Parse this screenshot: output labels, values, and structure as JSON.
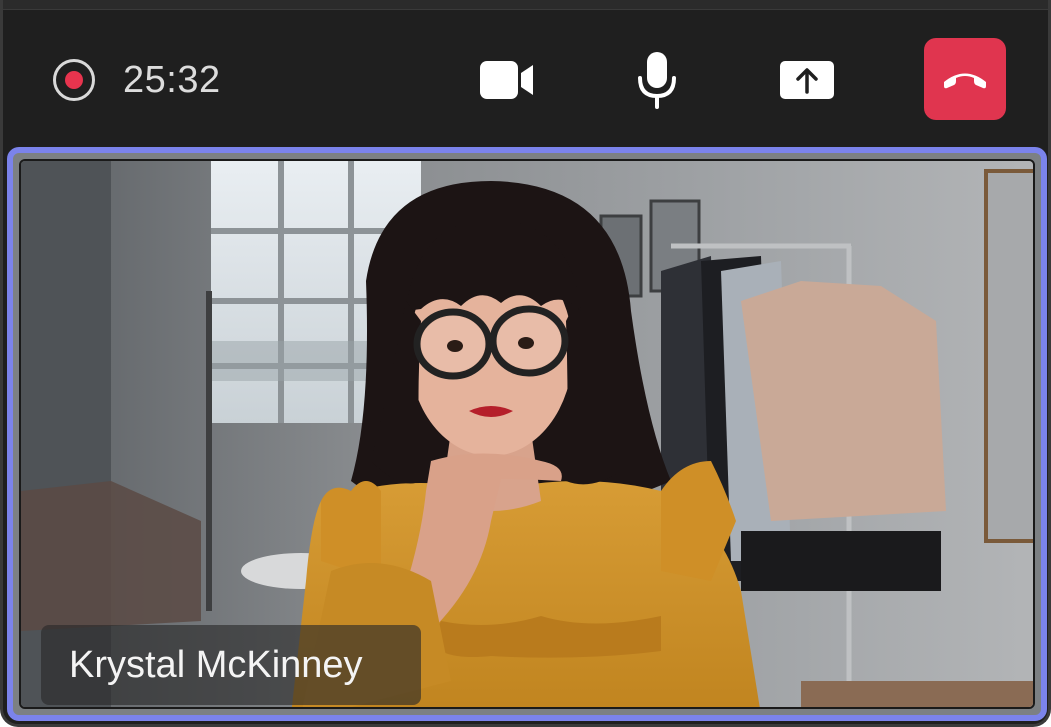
{
  "call": {
    "elapsed": "25:32"
  },
  "toolbar": {
    "recording_icon": "record-icon",
    "camera_icon": "video-camera-icon",
    "mic_icon": "microphone-icon",
    "share_icon": "share-screen-icon",
    "hangup_icon": "hang-up-icon",
    "recording_color": "#e8344e",
    "hangup_color": "#e0354f"
  },
  "participant": {
    "name": "Krystal McKinney"
  },
  "colors": {
    "active_speaker_border": "#7b83eb",
    "toolbar_background": "#1f1f1f"
  }
}
